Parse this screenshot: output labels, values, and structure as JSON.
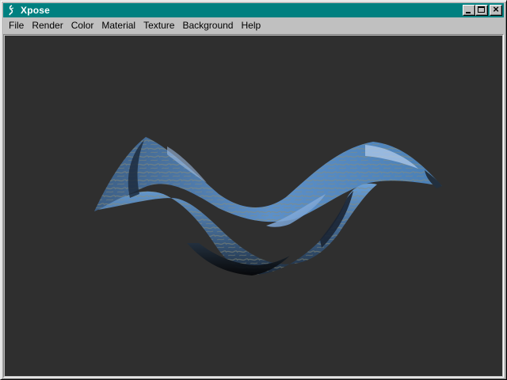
{
  "window": {
    "title": "Xpose",
    "app_icon": "xpose-app-icon"
  },
  "title_buttons": {
    "minimize_icon": "minimize-icon",
    "maximize_icon": "maximize-icon",
    "close_icon": "close-icon"
  },
  "menu": {
    "items": [
      "File",
      "Render",
      "Color",
      "Material",
      "Texture",
      "Background",
      "Help"
    ]
  },
  "viewport": {
    "background_color": "#2f2f2f",
    "object": "textured-3d-wavy-surface",
    "texture_colors": [
      "#5d90c8",
      "#3c5e84",
      "#8c8c72",
      "#a8c4ea"
    ]
  },
  "colors": {
    "titlebar": "#008080",
    "chrome": "#c0c0c0"
  }
}
